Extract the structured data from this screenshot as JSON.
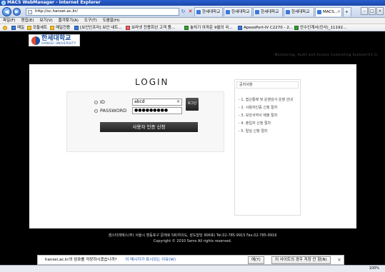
{
  "window": {
    "title": "MACS WebManager - Internet Explorer"
  },
  "address": {
    "url": "http://sc.hansei.ac.kr/"
  },
  "tabs": [
    {
      "label": "한세대학교"
    },
    {
      "label": "한세대학교"
    },
    {
      "label": "한세대학교"
    },
    {
      "label": "한세대학교"
    },
    {
      "label": "MACS..."
    }
  ],
  "menu": [
    "파일(F)",
    "편집(E)",
    "보기(V)",
    "즐겨찾기(A)",
    "도구(T)",
    "도움말(H)"
  ],
  "favorites": [
    {
      "label": "메일",
      "icon": "mail-icon"
    },
    {
      "label": "모듈세트",
      "icon": "folder-icon"
    },
    {
      "label": "메일전용",
      "icon": "folder-icon"
    },
    {
      "label": "[보안인프라] 보안 내트...",
      "icon": "page-icon"
    },
    {
      "label": "보라넷 전용회선 고객 품...",
      "icon": "page-icon"
    },
    {
      "label": "놓치기 아까운 9월의 국...",
      "icon": "page-icon"
    },
    {
      "label": "ApeosPort-IV C2270 - 2...",
      "icon": "page-icon"
    },
    {
      "label": "안수인계서(인사)_11192...",
      "icon": "page-icon"
    }
  ],
  "page": {
    "logo_kr": "한세대학교",
    "logo_en": "HANSEI UNIVERSITY",
    "system_name": "Monitoring, Audit and Access Controlling System(V3.1)",
    "login_title": "LOGIN",
    "id_label": "ID",
    "id_value": "abcd",
    "password_label": "PASSWORD",
    "password_value": "●●●●●●●●●",
    "login_button": "로그인",
    "cert_button": "사용자 인증 신청",
    "notice_title": "공지사항",
    "notices": [
      "- 1. 접근통제 및 운영감사 운영 안내",
      "- 2. 사용자인증 신청 절차",
      "- 3. 보안서약서 제출 절차",
      "- 4. 출입자 신청 절차",
      "- 5. 탈실 신청 절차"
    ],
    "footer_line1": "셈스티레에스(주) 서울시 영등포구 문래로 58(여의도, 삼도빌딩 906호) Tel.02-785-9915 Fax.02-785-9916",
    "footer_line2": "Copyright © 2010 Sems All rights reserved."
  },
  "infobar": {
    "message": "hansei.ac.kr의 암호를 저장하시겠습니까?",
    "link": "이 메시지가 표시되는 이유(W)",
    "yes": "예(Y)",
    "never": "이 사이트의 경우 저장 안 함(N)",
    "close": "×"
  },
  "status": {
    "zoom": "100%"
  }
}
